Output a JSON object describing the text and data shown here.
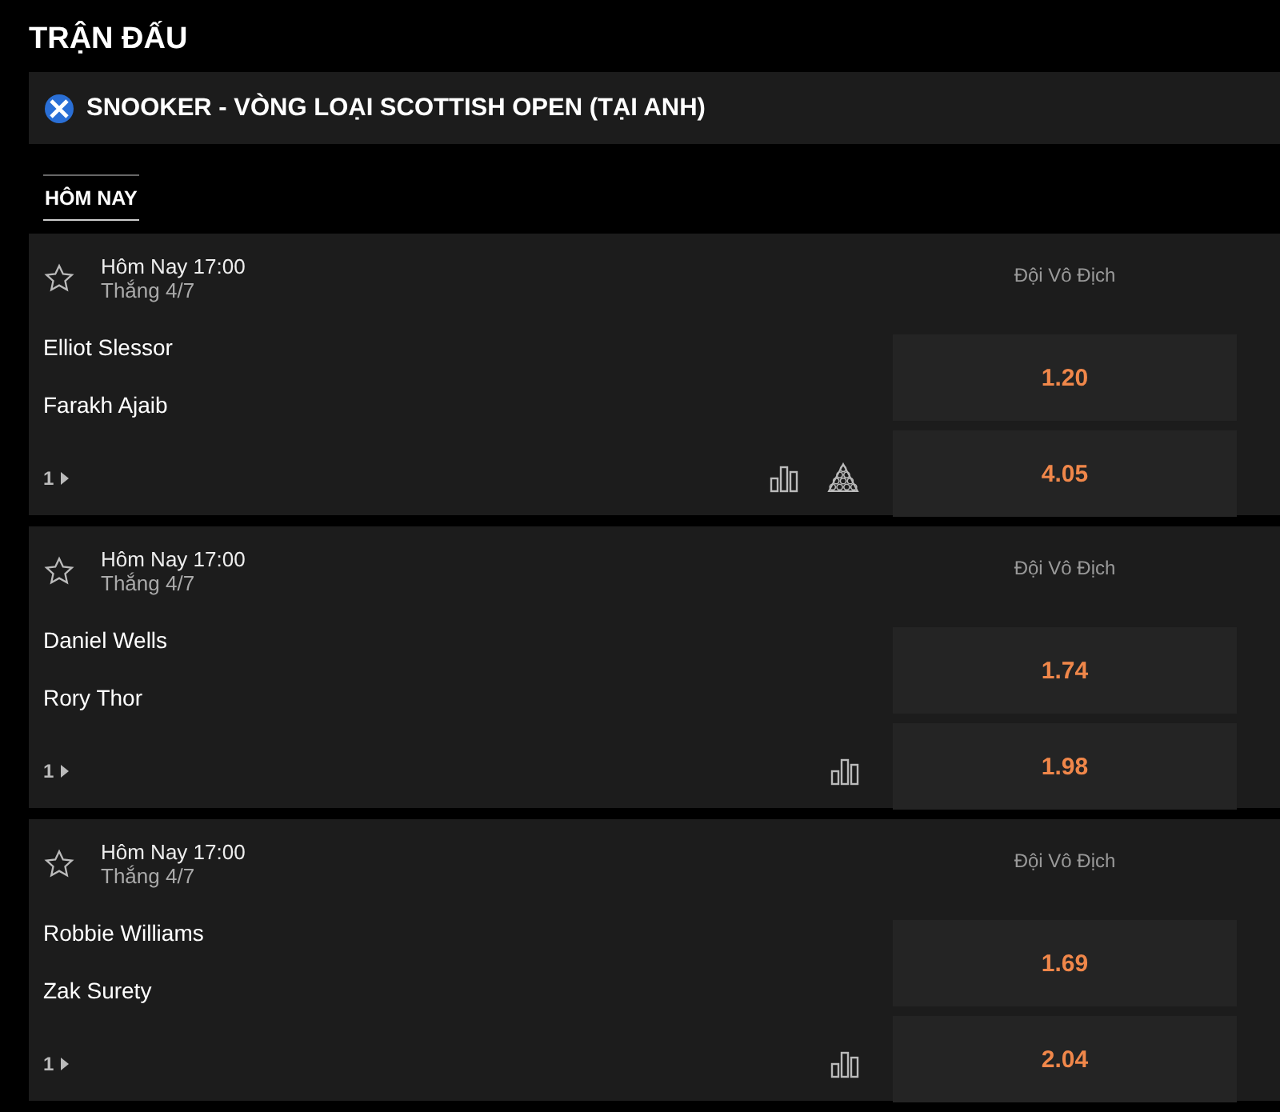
{
  "page_title": "TRẬN ĐẤU",
  "league": {
    "name": "SNOOKER - VÒNG LOẠI SCOTTISH OPEN (TẠI ANH)"
  },
  "tabs": [
    {
      "label": "HÔM NAY",
      "selected": true
    }
  ],
  "matches": [
    {
      "time": "Hôm Nay 17:00",
      "stage": "Thắng 4/7",
      "market": "Đội Vô Địch",
      "players": [
        "Elliot Slessor",
        "Farakh Ajaib"
      ],
      "odds": [
        "1.20",
        "4.05"
      ],
      "more": "1",
      "rack": true
    },
    {
      "time": "Hôm Nay 17:00",
      "stage": "Thắng 4/7",
      "market": "Đội Vô Địch",
      "players": [
        "Daniel Wells",
        "Rory Thor"
      ],
      "odds": [
        "1.74",
        "1.98"
      ],
      "more": "1",
      "rack": false
    },
    {
      "time": "Hôm Nay 17:00",
      "stage": "Thắng 4/7",
      "market": "Đội Vô Địch",
      "players": [
        "Robbie Williams",
        "Zak Surety"
      ],
      "odds": [
        "1.69",
        "2.04"
      ],
      "more": "1",
      "rack": false
    }
  ]
}
